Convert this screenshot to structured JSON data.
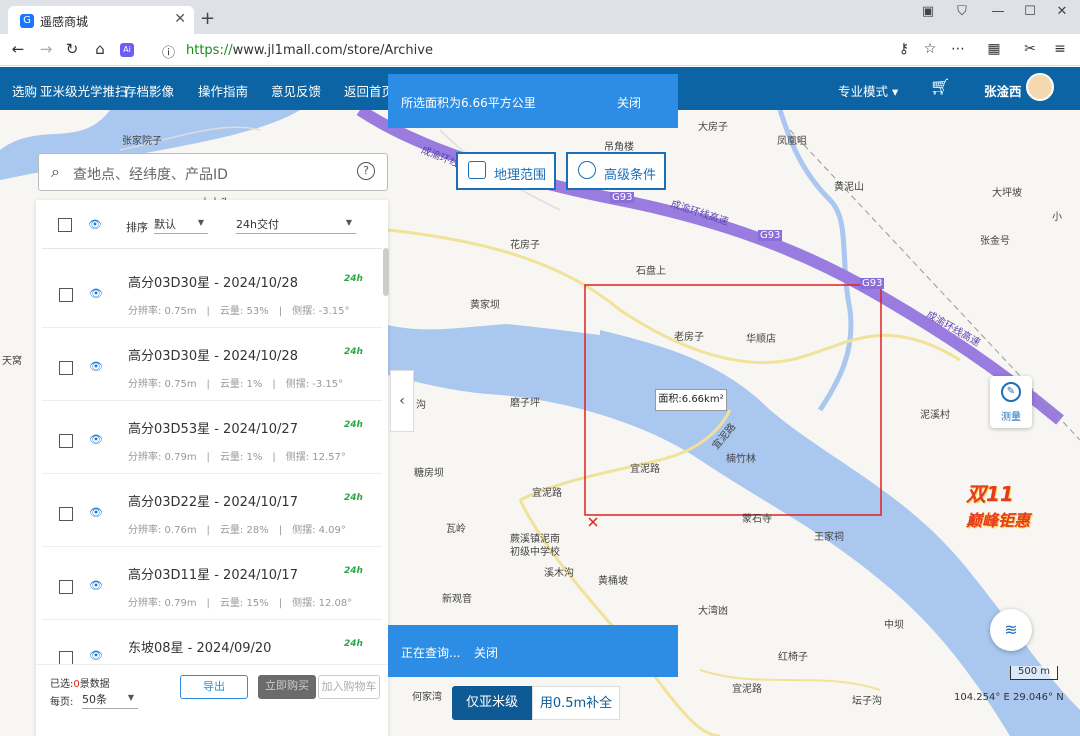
{
  "browser": {
    "tab_title": "遥感商城",
    "tab_favicon": "G",
    "url_scheme": "https://",
    "url_rest": "www.jl1mall.com/store/Archive"
  },
  "appnav": {
    "items": [
      "选购",
      "亚米级光学推扫",
      "存档影像",
      "操作指南",
      "意见反馈",
      "返回首页"
    ],
    "mode": "专业模式",
    "user": "张淦西"
  },
  "notices": {
    "area_msg": "所选面积为6.66平方公里",
    "area_close": "关闭",
    "query_msg": "正在查询...",
    "query_close": "关闭"
  },
  "tools": {
    "geo_range": "地理范围",
    "advanced": "高级条件"
  },
  "search": {
    "placeholder": "查地点、经纬度、产品ID",
    "help": "?"
  },
  "listhead": {
    "sort_label": "排序",
    "sort_value": "默认",
    "delivery_value": "24h交付"
  },
  "results": [
    {
      "name": "高分03D30星 - 2024/10/28",
      "res": "分辨率: 0.75m",
      "cloud": "云量: 53%",
      "tilt": "侧摆: -3.15°"
    },
    {
      "name": "高分03D30星 - 2024/10/28",
      "res": "分辨率: 0.75m",
      "cloud": "云量: 1%",
      "tilt": "侧摆: -3.15°"
    },
    {
      "name": "高分03D53星 - 2024/10/27",
      "res": "分辨率: 0.79m",
      "cloud": "云量: 1%",
      "tilt": "侧摆: 12.57°"
    },
    {
      "name": "高分03D22星 - 2024/10/17",
      "res": "分辨率: 0.76m",
      "cloud": "云量: 28%",
      "tilt": "侧摆: 4.09°"
    },
    {
      "name": "高分03D11星 - 2024/10/17",
      "res": "分辨率: 0.79m",
      "cloud": "云量: 15%",
      "tilt": "侧摆: 12.08°"
    },
    {
      "name": "东坡08星 - 2024/09/20",
      "res": "",
      "cloud": "",
      "tilt": ""
    }
  ],
  "badge_24h": "24h",
  "footer": {
    "selected_prefix": "已选:",
    "selected_count": "0",
    "selected_suffix": "景数据",
    "per_page_label": "每页:",
    "per_page_value": "50条",
    "export": "导出",
    "buy_now": "立即购买",
    "add_cart": "加入购物车"
  },
  "map": {
    "area_tag": "面积:6.66km²",
    "measure": "测量",
    "scale": "500 m",
    "coord": "104.254° E  29.046° N",
    "labels": [
      "张家院子",
      "大土头",
      "吊角楼",
      "大房子",
      "凤凰咀",
      "黄泥山",
      "大坪坡",
      "张金号",
      "花房子",
      "石盘上",
      "黄家坝",
      "老房子",
      "华顺店",
      "磨子坪",
      "泥溪村",
      "楠竹林",
      "糖房坝",
      "瓦岭",
      "蕨溪镇泥南",
      "初级中学校",
      "王家祠",
      "溪木沟",
      "黄桶坡",
      "新观音",
      "大湾凼",
      "中坝",
      "红椅子",
      "坛子沟",
      "何家湾",
      "成渝环线高速",
      "成渝环线高速",
      "成渝环线高速",
      "宜泥路",
      "宜泥路",
      "宜泥路",
      "宜泥路",
      "天窝",
      "蒙石寺",
      "沟",
      "小"
    ],
    "road_codes": [
      "G93",
      "G93",
      "G93"
    ]
  },
  "promo": {
    "big": "双11",
    "sub": "巅峰钜惠"
  },
  "bottom_tabs": {
    "active": "仅亚米级",
    "other": "用0.5m补全"
  }
}
